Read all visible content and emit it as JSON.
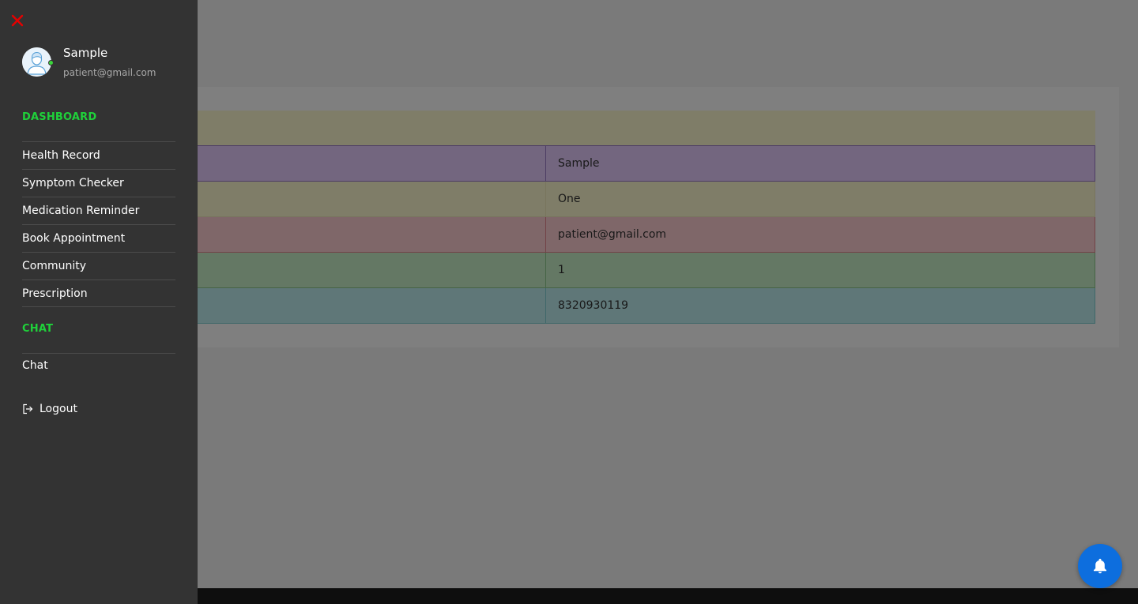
{
  "profile": {
    "name": "Sample",
    "email": "patient@gmail.com",
    "status_color": "#3ad63a"
  },
  "sidebar": {
    "dashboard_label": "DASHBOARD",
    "items": [
      {
        "label": "Health Record"
      },
      {
        "label": "Symptom Checker"
      },
      {
        "label": "Medication Reminder"
      },
      {
        "label": "Book Appointment"
      },
      {
        "label": "Community"
      },
      {
        "label": "Prescription"
      }
    ],
    "chat_label": "CHAT",
    "chat_item": "Chat",
    "logout_label": "Logout",
    "accent_color": "#1fd13a",
    "close_icon_color": "#e60000"
  },
  "details_table": {
    "rows": [
      {
        "label": "",
        "value": "Sample"
      },
      {
        "label": "",
        "value": "One"
      },
      {
        "label": "",
        "value": "patient@gmail.com"
      },
      {
        "label": "",
        "value": "1"
      },
      {
        "label": "",
        "value": "8320930119"
      }
    ]
  },
  "icons": {
    "close": "close-icon",
    "avatar": "user-avatar-icon",
    "logout": "logout-icon",
    "notification": "bell-icon"
  },
  "colors": {
    "notification_button": "#0d6ede"
  }
}
